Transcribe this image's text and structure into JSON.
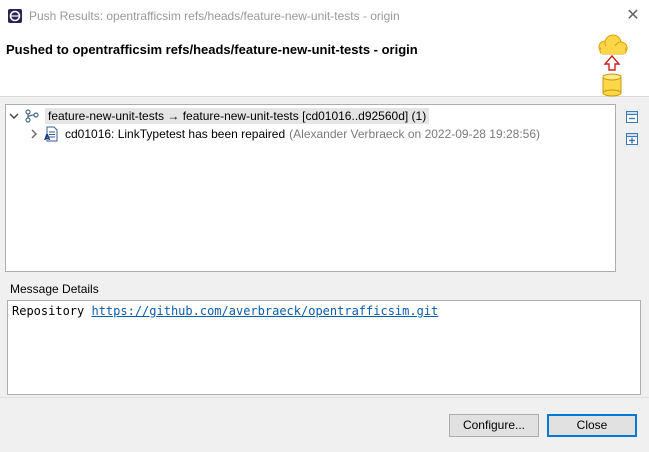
{
  "window": {
    "title": "Push Results: opentrafficsim refs/heads/feature-new-unit-tests - origin",
    "close_glyph": "✕"
  },
  "header": {
    "title": "Pushed to opentrafficsim refs/heads/feature-new-unit-tests - origin",
    "icon": "cloud-push-to-repository-icon"
  },
  "tree": {
    "ref_update": {
      "label": "feature-new-unit-tests → feature-new-unit-tests [cd01016..d92560d] (1)",
      "expanded": true,
      "icon": "branch-icon"
    },
    "commits": [
      {
        "message": "cd01016: LinkTypetest has been repaired",
        "meta": "(Alexander Verbraeck on 2022-09-28 19:28:56)",
        "icon": "commit-file-icon"
      }
    ]
  },
  "toolbar": {
    "collapse_all_icon": "collapse-all-icon",
    "expand_all_icon": "expand-all-icon"
  },
  "message_details": {
    "label": "Message Details",
    "prefix": "Repository",
    "url": "https://github.com/averbraeck/opentrafficsim.git"
  },
  "buttons": {
    "configure_label": "Configure...",
    "close_label": "Close"
  },
  "colors": {
    "accent": "#0078d7",
    "link": "#0b5cad",
    "meta_text": "#7a7a7a",
    "selection": "#e5e5e5"
  }
}
